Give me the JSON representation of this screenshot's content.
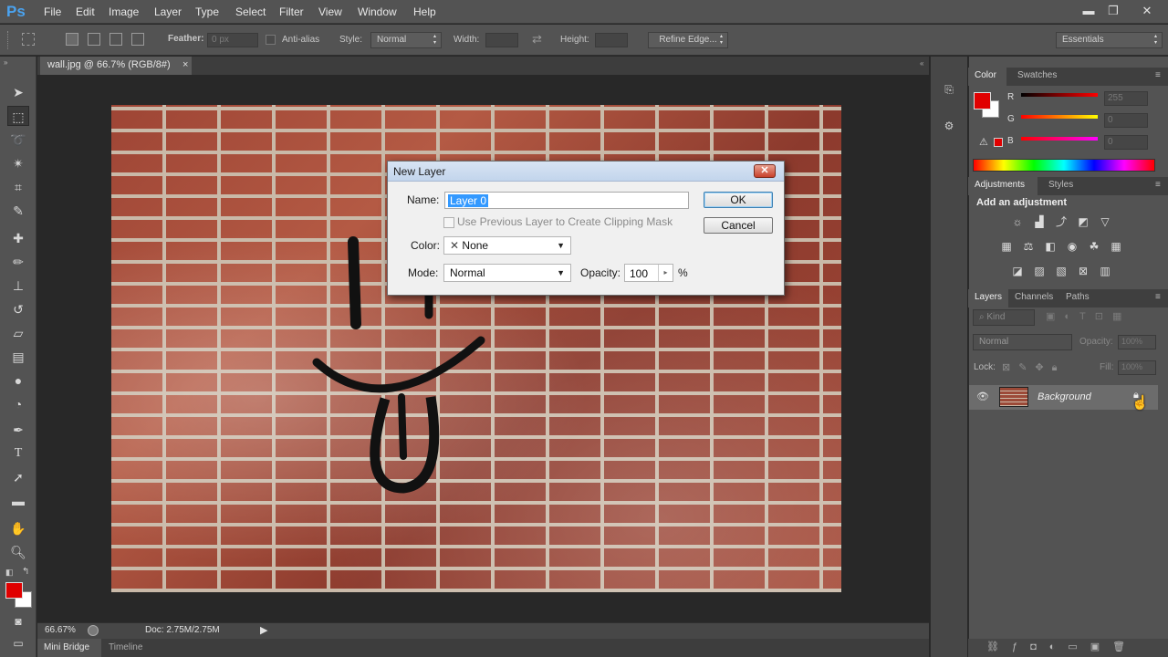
{
  "app": {
    "logo": "Ps"
  },
  "menu": [
    "File",
    "Edit",
    "Image",
    "Layer",
    "Type",
    "Select",
    "Filter",
    "View",
    "Window",
    "Help"
  ],
  "window_controls": {
    "minimize": "▬",
    "restore": "❐",
    "close": "✕"
  },
  "options_bar": {
    "feather_label": "Feather:",
    "feather_value": "0 px",
    "antialias_label": "Anti-alias",
    "style_label": "Style:",
    "style_value": "Normal",
    "width_label": "Width:",
    "height_label": "Height:",
    "refine_edge": "Refine Edge...",
    "workspace": "Essentials"
  },
  "document": {
    "tab_title": "wall.jpg @ 66.7% (RGB/8#)",
    "tab_close": "×",
    "zoom": "66.67%",
    "doc_size": "Doc: 2.75M/2.75M"
  },
  "bottom_tabs": [
    "Mini Bridge",
    "Timeline"
  ],
  "color_panel": {
    "tabs": [
      "Color",
      "Swatches"
    ],
    "channels": [
      {
        "label": "R",
        "value": "255"
      },
      {
        "label": "G",
        "value": "0"
      },
      {
        "label": "B",
        "value": "0"
      }
    ],
    "foreground": "#e00000",
    "background": "#ffffff"
  },
  "adjustments_panel": {
    "tabs": [
      "Adjustments",
      "Styles"
    ],
    "heading": "Add an adjustment"
  },
  "layers_panel": {
    "tabs": [
      "Layers",
      "Channels",
      "Paths"
    ],
    "filter_label": "Kind",
    "blend_mode": "Normal",
    "opacity_label": "Opacity:",
    "opacity_value": "100%",
    "lock_label": "Lock:",
    "fill_label": "Fill:",
    "fill_value": "100%",
    "layers": [
      {
        "name": "Background",
        "visible": true,
        "locked": true
      }
    ]
  },
  "dialog": {
    "title": "New Layer",
    "close": "✕",
    "name_label": "Name:",
    "name_value": "Layer 0",
    "clipping_label": "Use Previous Layer to Create Clipping Mask",
    "color_label": "Color:",
    "color_value": "None",
    "mode_label": "Mode:",
    "mode_value": "Normal",
    "opacity_label": "Opacity:",
    "opacity_value": "100",
    "opacity_unit": "%",
    "ok": "OK",
    "cancel": "Cancel"
  }
}
